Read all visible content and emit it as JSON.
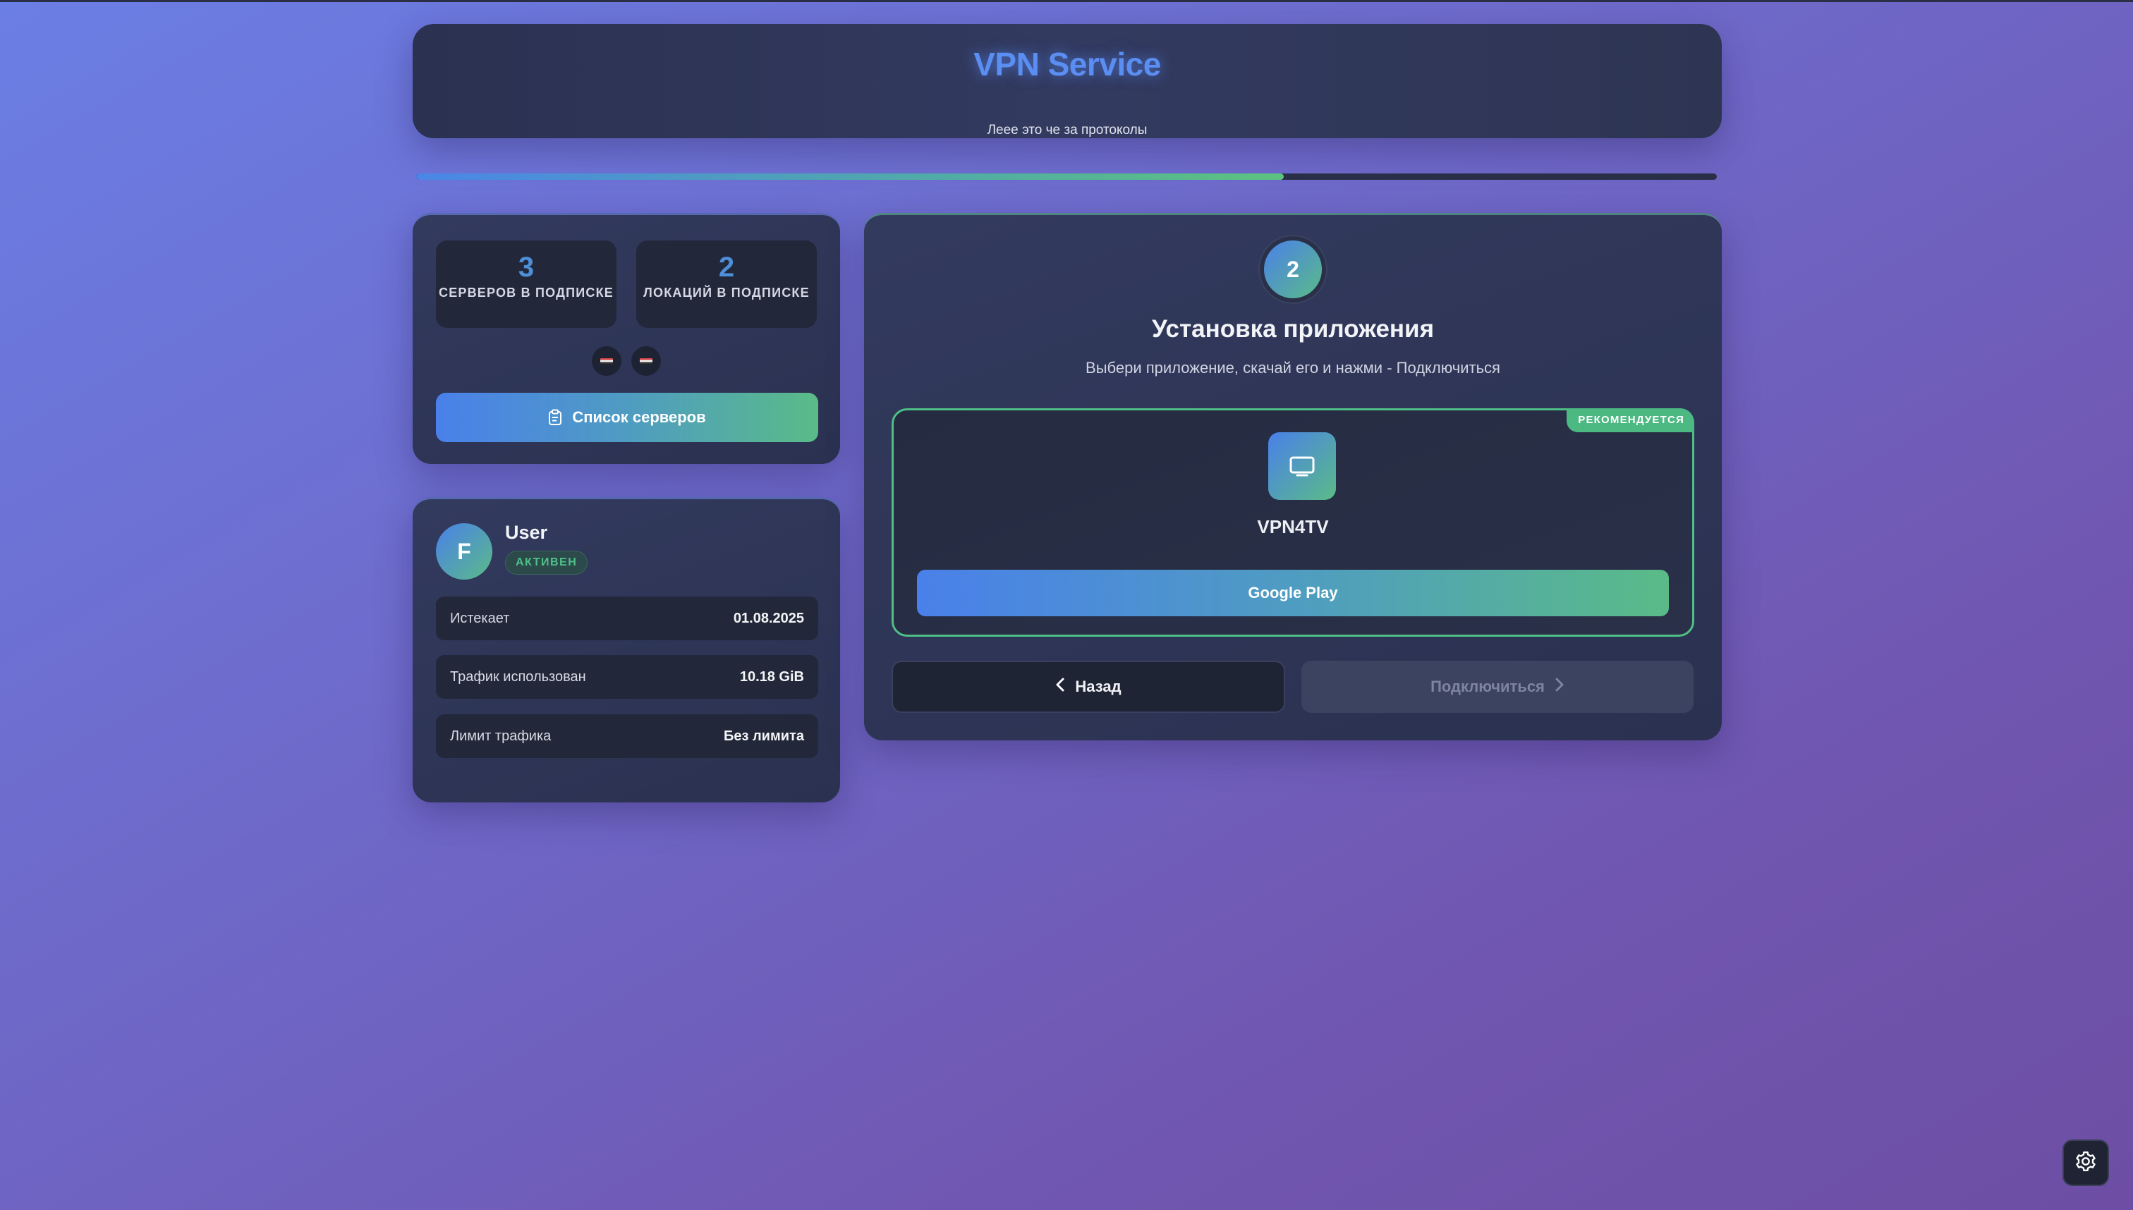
{
  "header": {
    "title": "VPN Service",
    "subtitle": "Леее это че за протоколы"
  },
  "progress": {
    "percent": 66.7
  },
  "stats": {
    "servers_count": "3",
    "servers_label": "СЕРВЕРОВ В ПОДПИСКЕ",
    "locations_count": "2",
    "locations_label": "ЛОКАЦИЙ В ПОДПИСКЕ",
    "flags": [
      "flag-icon",
      "flag-icon"
    ],
    "servers_button": "Список серверов"
  },
  "user": {
    "avatar_letter": "F",
    "name": "User",
    "status": "АКТИВЕН",
    "rows": [
      {
        "label": "Истекает",
        "value": "01.08.2025"
      },
      {
        "label": "Трафик использован",
        "value": "10.18 GiB"
      },
      {
        "label": "Лимит трафика",
        "value": "Без лимита"
      }
    ]
  },
  "wizard": {
    "step_number": "2",
    "title": "Установка приложения",
    "subtitle": "Выбери приложение, скачай его и нажми - Подключиться",
    "app": {
      "badge": "РЕКОМЕНДУЕТСЯ",
      "icon": "tv-icon",
      "name": "VPN4TV",
      "store_button": "Google Play"
    },
    "back_button": "Назад",
    "connect_button": "Подключиться"
  },
  "colors": {
    "accent_blue": "#4a80ea",
    "accent_green": "#5abb87",
    "title_glow": "#5b8ef2",
    "status_green": "#4fc08a"
  }
}
